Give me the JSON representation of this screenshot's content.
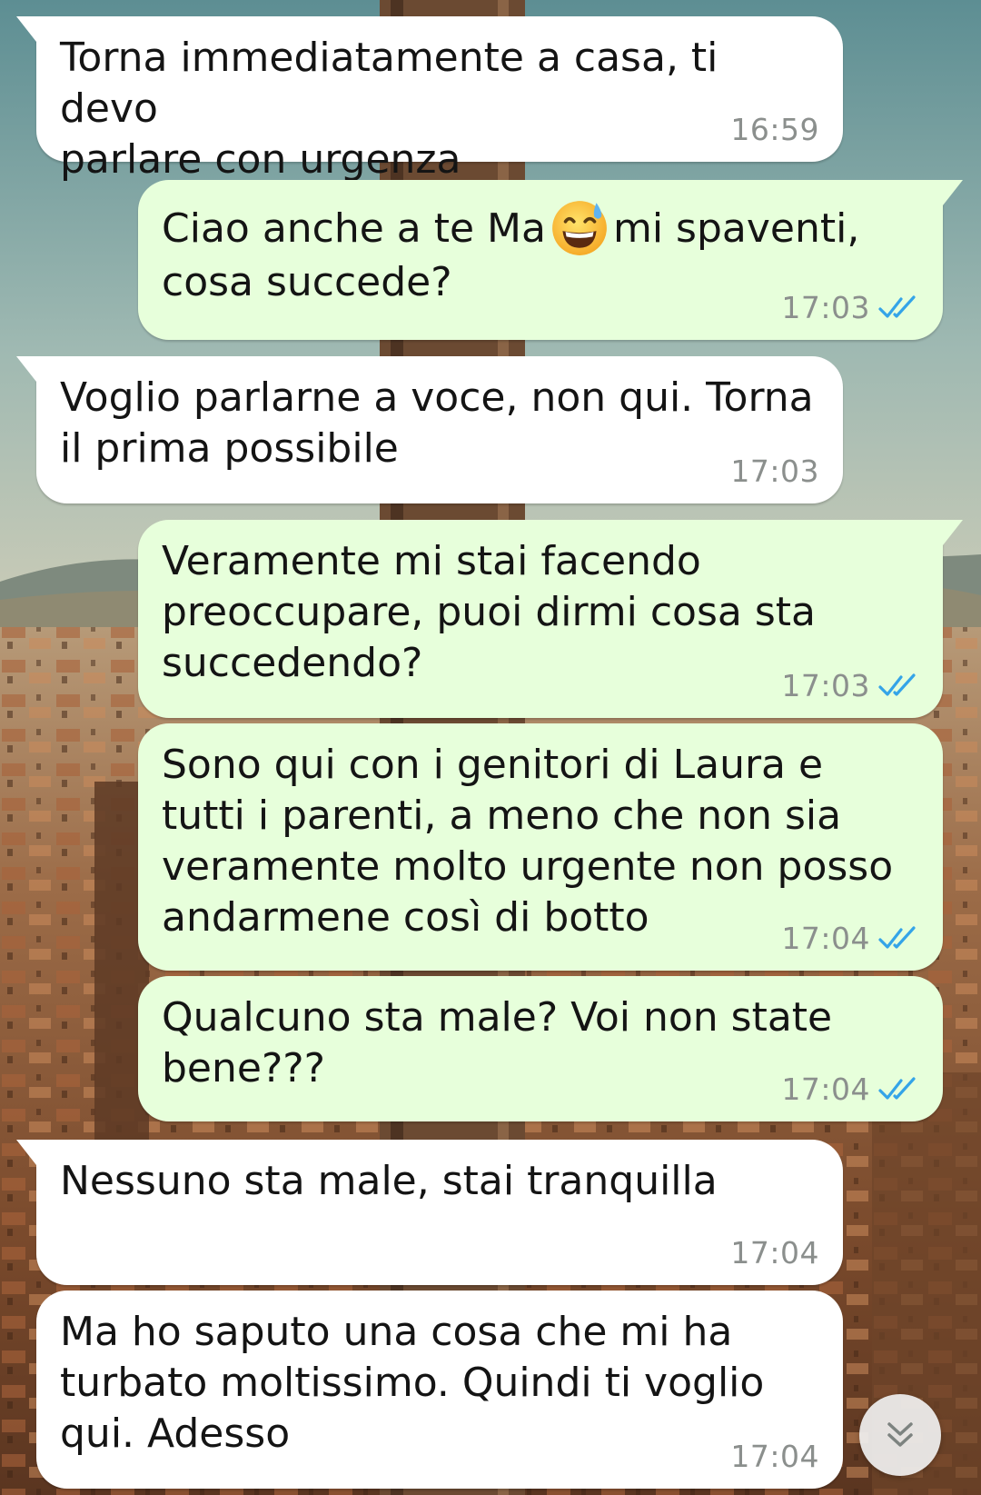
{
  "app": {
    "colors": {
      "incoming_bubble": "#ffffff",
      "outgoing_bubble": "#e7ffdb",
      "read_ticks": "#34a4e8",
      "timestamp": "#8b8f8d"
    }
  },
  "messages": [
    {
      "direction": "incoming",
      "text": "Torna immediatamente a casa, ti devo\nparlare con urgenza",
      "time": "16:59"
    },
    {
      "direction": "outgoing",
      "text_before": "Ciao anche a te Ma",
      "emoji": "grinning-face-with-sweat",
      "text_after": "mi spaventi,\ncosa succede?",
      "time": "17:03",
      "status": "read"
    },
    {
      "direction": "incoming",
      "text": "Voglio parlarne a voce, non qui. Torna\nil prima possibile",
      "time": "17:03"
    },
    {
      "direction": "outgoing",
      "text": "Veramente mi stai facendo\npreoccupare, puoi dirmi cosa sta\nsuccedendo?",
      "time": "17:03",
      "status": "read"
    },
    {
      "direction": "outgoing",
      "text": "Sono qui con i genitori di Laura e\ntutti i parenti, a meno che non sia\nveramente molto urgente non posso\nandarmene così di botto",
      "time": "17:04",
      "status": "read"
    },
    {
      "direction": "outgoing",
      "text": "Qualcuno sta male? Voi non state\nbene???",
      "time": "17:04",
      "status": "read"
    },
    {
      "direction": "incoming",
      "text": "Nessuno sta male, stai tranquilla",
      "time": "17:04"
    },
    {
      "direction": "incoming",
      "text": "Ma ho saputo una cosa che mi ha\nturbato moltissimo. Quindi ti voglio\nqui. Adesso",
      "time": "17:04"
    }
  ],
  "scroll_to_bottom": {
    "icon": "double-chevron-down-icon"
  }
}
